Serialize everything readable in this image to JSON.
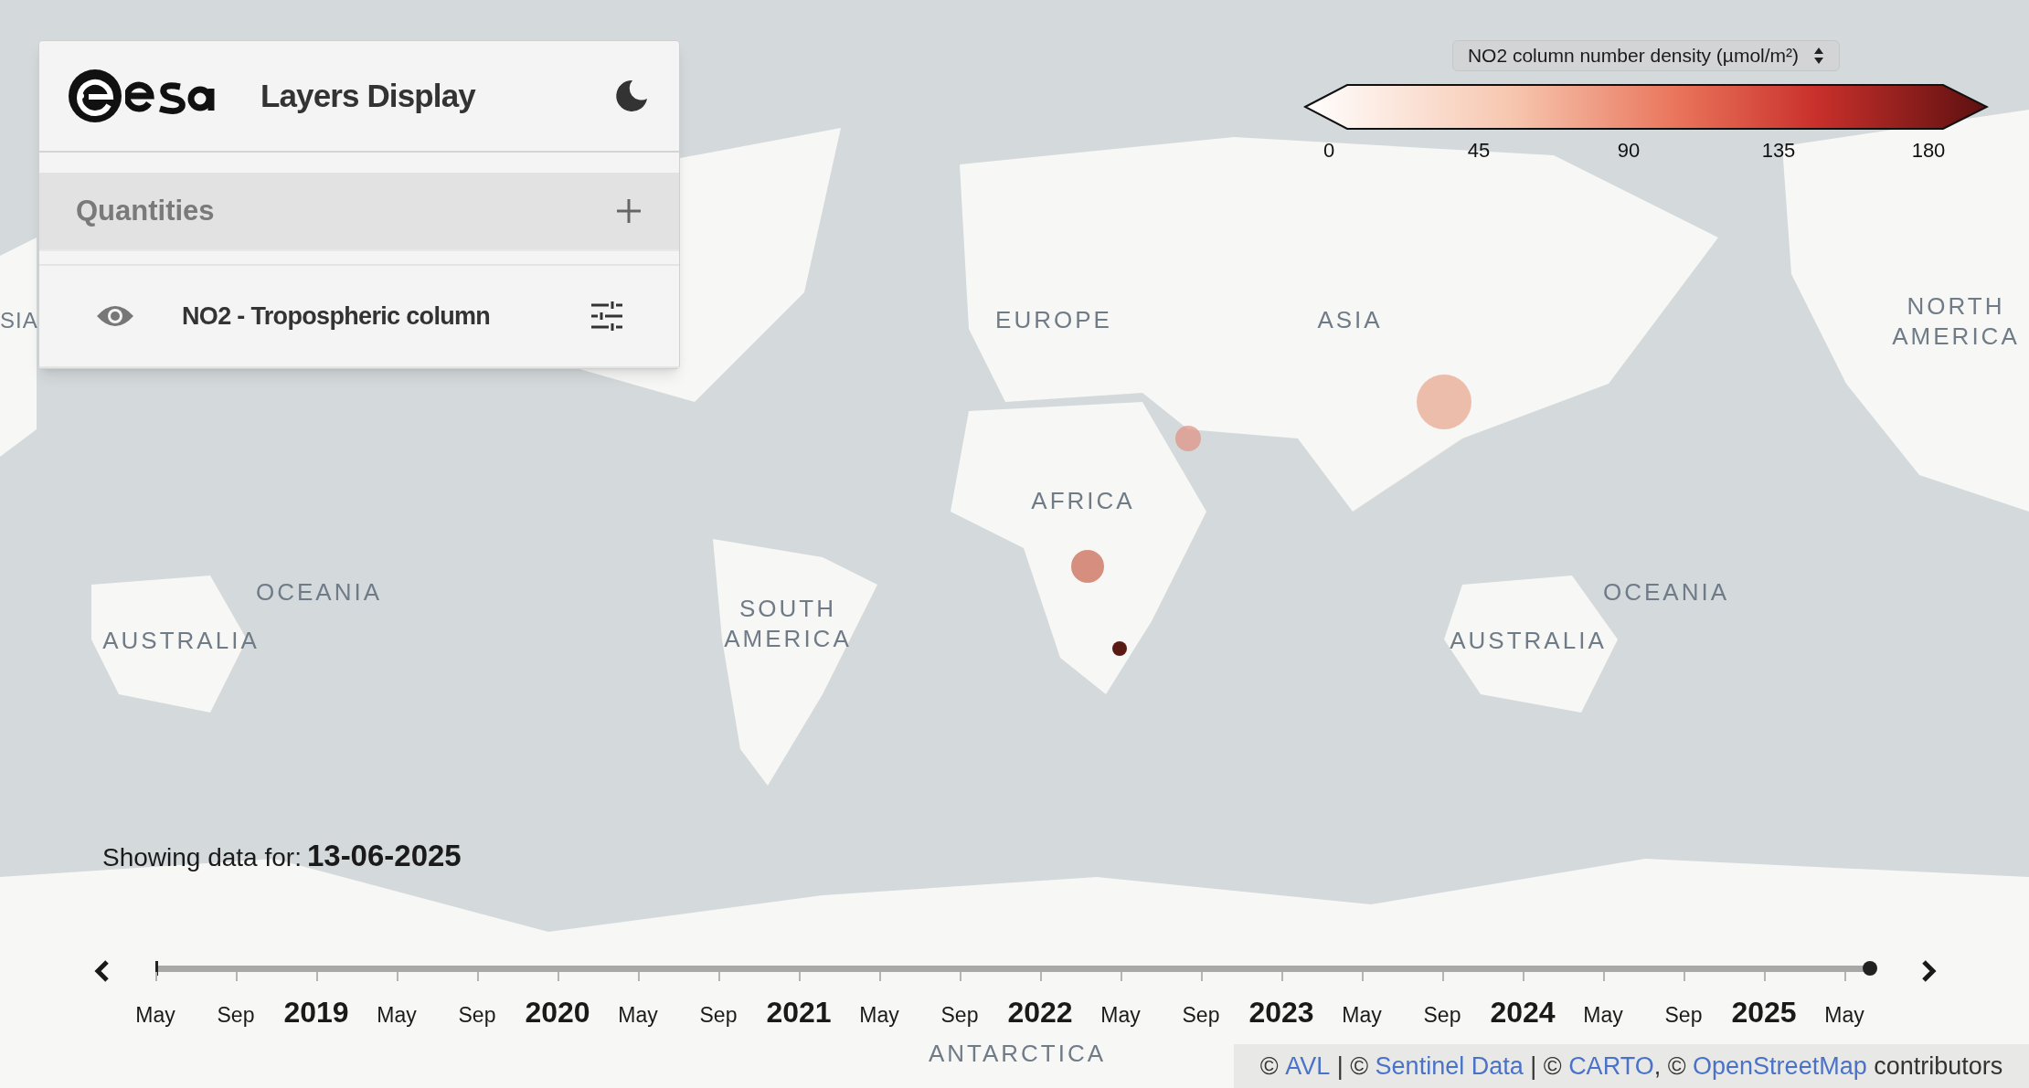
{
  "panel": {
    "title": "Layers Display",
    "section": {
      "label": "Quantities",
      "expanded": false
    },
    "layers": [
      {
        "name": "NO2 - Tropospheric column",
        "visible": true
      }
    ]
  },
  "legend": {
    "selector": "NO2 column number density (µmol/m²)",
    "ticks": [
      "0",
      "45",
      "90",
      "135",
      "180"
    ]
  },
  "map_labels": [
    "SIA",
    "EUROPE",
    "ASIA",
    "NORTH AMERICA",
    "AFRICA",
    "OCEANIA",
    "AUSTRALIA",
    "SOUTH AMERICA",
    "OCEANIA",
    "AUSTRALIA",
    "ANTARCTICA"
  ],
  "date": {
    "label": "Showing data for:",
    "value": "13-06-2025"
  },
  "timeline": {
    "level": 1,
    "labels": [
      {
        "text": "May",
        "kind": "month"
      },
      {
        "text": "Sep",
        "kind": "month"
      },
      {
        "text": "2019",
        "kind": "year"
      },
      {
        "text": "May",
        "kind": "month"
      },
      {
        "text": "Sep",
        "kind": "month"
      },
      {
        "text": "2020",
        "kind": "year"
      },
      {
        "text": "May",
        "kind": "month"
      },
      {
        "text": "Sep",
        "kind": "month"
      },
      {
        "text": "2021",
        "kind": "year"
      },
      {
        "text": "May",
        "kind": "month"
      },
      {
        "text": "Sep",
        "kind": "month"
      },
      {
        "text": "2022",
        "kind": "year"
      },
      {
        "text": "May",
        "kind": "month"
      },
      {
        "text": "Sep",
        "kind": "month"
      },
      {
        "text": "2023",
        "kind": "year"
      },
      {
        "text": "May",
        "kind": "month"
      },
      {
        "text": "Sep",
        "kind": "month"
      },
      {
        "text": "2024",
        "kind": "year"
      },
      {
        "text": "May",
        "kind": "month"
      },
      {
        "text": "Sep",
        "kind": "month"
      },
      {
        "text": "2025",
        "kind": "year"
      },
      {
        "text": "May",
        "kind": "month"
      }
    ]
  },
  "attribution": [
    {
      "text": "© ",
      "kind": "text"
    },
    {
      "text": "AVL",
      "kind": "link"
    },
    {
      "text": " | © ",
      "kind": "text"
    },
    {
      "text": "Sentinel Data",
      "kind": "link"
    },
    {
      "text": " | © ",
      "kind": "text"
    },
    {
      "text": "CARTO",
      "kind": "link"
    },
    {
      "text": ", © ",
      "kind": "text"
    },
    {
      "text": "OpenStreetMap",
      "kind": "link"
    },
    {
      "text": " contributors",
      "kind": "text"
    }
  ]
}
